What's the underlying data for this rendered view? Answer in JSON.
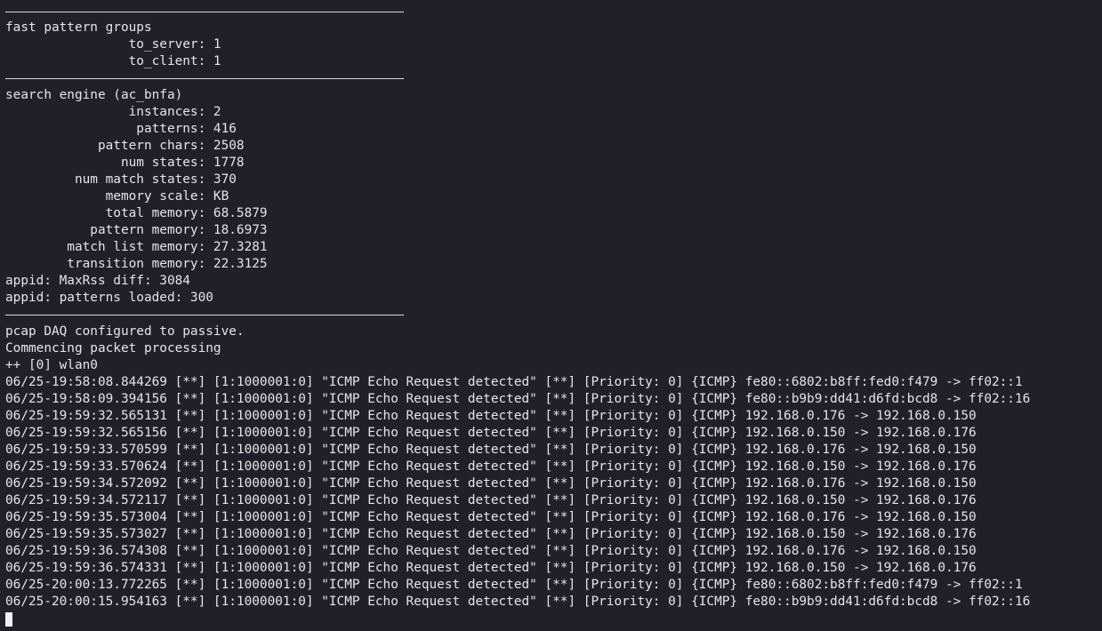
{
  "terminal": {
    "fast_pattern": {
      "title": "fast pattern groups",
      "to_server": "                to_server: 1",
      "to_client": "                to_client: 1"
    },
    "search_engine": {
      "title": "search engine (ac_bnfa)",
      "instances": "                instances: 2",
      "patterns": "                 patterns: 416",
      "pattern_chars": "            pattern chars: 2508",
      "num_states": "               num states: 1778",
      "num_match_states": "         num match states: 370",
      "memory_scale": "             memory scale: KB",
      "total_memory": "             total memory: 68.5879",
      "pattern_memory": "           pattern memory: 18.6973",
      "match_list_memory": "        match list memory: 27.3281",
      "transition_memory": "        transition memory: 22.3125"
    },
    "appid": {
      "maxrss": "appid: MaxRss diff: 3084",
      "patterns_loaded": "appid: patterns loaded: 300"
    },
    "status": {
      "daq": "pcap DAQ configured to passive.",
      "commencing": "Commencing packet processing",
      "interface": "++ [0] wlan0"
    },
    "alerts": [
      "06/25-19:58:08.844269 [**] [1:1000001:0] \"ICMP Echo Request detected\" [**] [Priority: 0] {ICMP} fe80::6802:b8ff:fed0:f479 -> ff02::1",
      "06/25-19:58:09.394156 [**] [1:1000001:0] \"ICMP Echo Request detected\" [**] [Priority: 0] {ICMP} fe80::b9b9:dd41:d6fd:bcd8 -> ff02::16",
      "06/25-19:59:32.565131 [**] [1:1000001:0] \"ICMP Echo Request detected\" [**] [Priority: 0] {ICMP} 192.168.0.176 -> 192.168.0.150",
      "06/25-19:59:32.565156 [**] [1:1000001:0] \"ICMP Echo Request detected\" [**] [Priority: 0] {ICMP} 192.168.0.150 -> 192.168.0.176",
      "06/25-19:59:33.570599 [**] [1:1000001:0] \"ICMP Echo Request detected\" [**] [Priority: 0] {ICMP} 192.168.0.176 -> 192.168.0.150",
      "06/25-19:59:33.570624 [**] [1:1000001:0] \"ICMP Echo Request detected\" [**] [Priority: 0] {ICMP} 192.168.0.150 -> 192.168.0.176",
      "06/25-19:59:34.572092 [**] [1:1000001:0] \"ICMP Echo Request detected\" [**] [Priority: 0] {ICMP} 192.168.0.176 -> 192.168.0.150",
      "06/25-19:59:34.572117 [**] [1:1000001:0] \"ICMP Echo Request detected\" [**] [Priority: 0] {ICMP} 192.168.0.150 -> 192.168.0.176",
      "06/25-19:59:35.573004 [**] [1:1000001:0] \"ICMP Echo Request detected\" [**] [Priority: 0] {ICMP} 192.168.0.176 -> 192.168.0.150",
      "06/25-19:59:35.573027 [**] [1:1000001:0] \"ICMP Echo Request detected\" [**] [Priority: 0] {ICMP} 192.168.0.150 -> 192.168.0.176",
      "06/25-19:59:36.574308 [**] [1:1000001:0] \"ICMP Echo Request detected\" [**] [Priority: 0] {ICMP} 192.168.0.176 -> 192.168.0.150",
      "06/25-19:59:36.574331 [**] [1:1000001:0] \"ICMP Echo Request detected\" [**] [Priority: 0] {ICMP} 192.168.0.150 -> 192.168.0.176",
      "06/25-20:00:13.772265 [**] [1:1000001:0] \"ICMP Echo Request detected\" [**] [Priority: 0] {ICMP} fe80::6802:b8ff:fed0:f479 -> ff02::1",
      "06/25-20:00:15.954163 [**] [1:1000001:0] \"ICMP Echo Request detected\" [**] [Priority: 0] {ICMP} fe80::b9b9:dd41:d6fd:bcd8 -> ff02::16"
    ],
    "colors": {
      "background": "#1f2029",
      "text": "#e6e6e6",
      "separator": "#d9d9d9"
    }
  }
}
